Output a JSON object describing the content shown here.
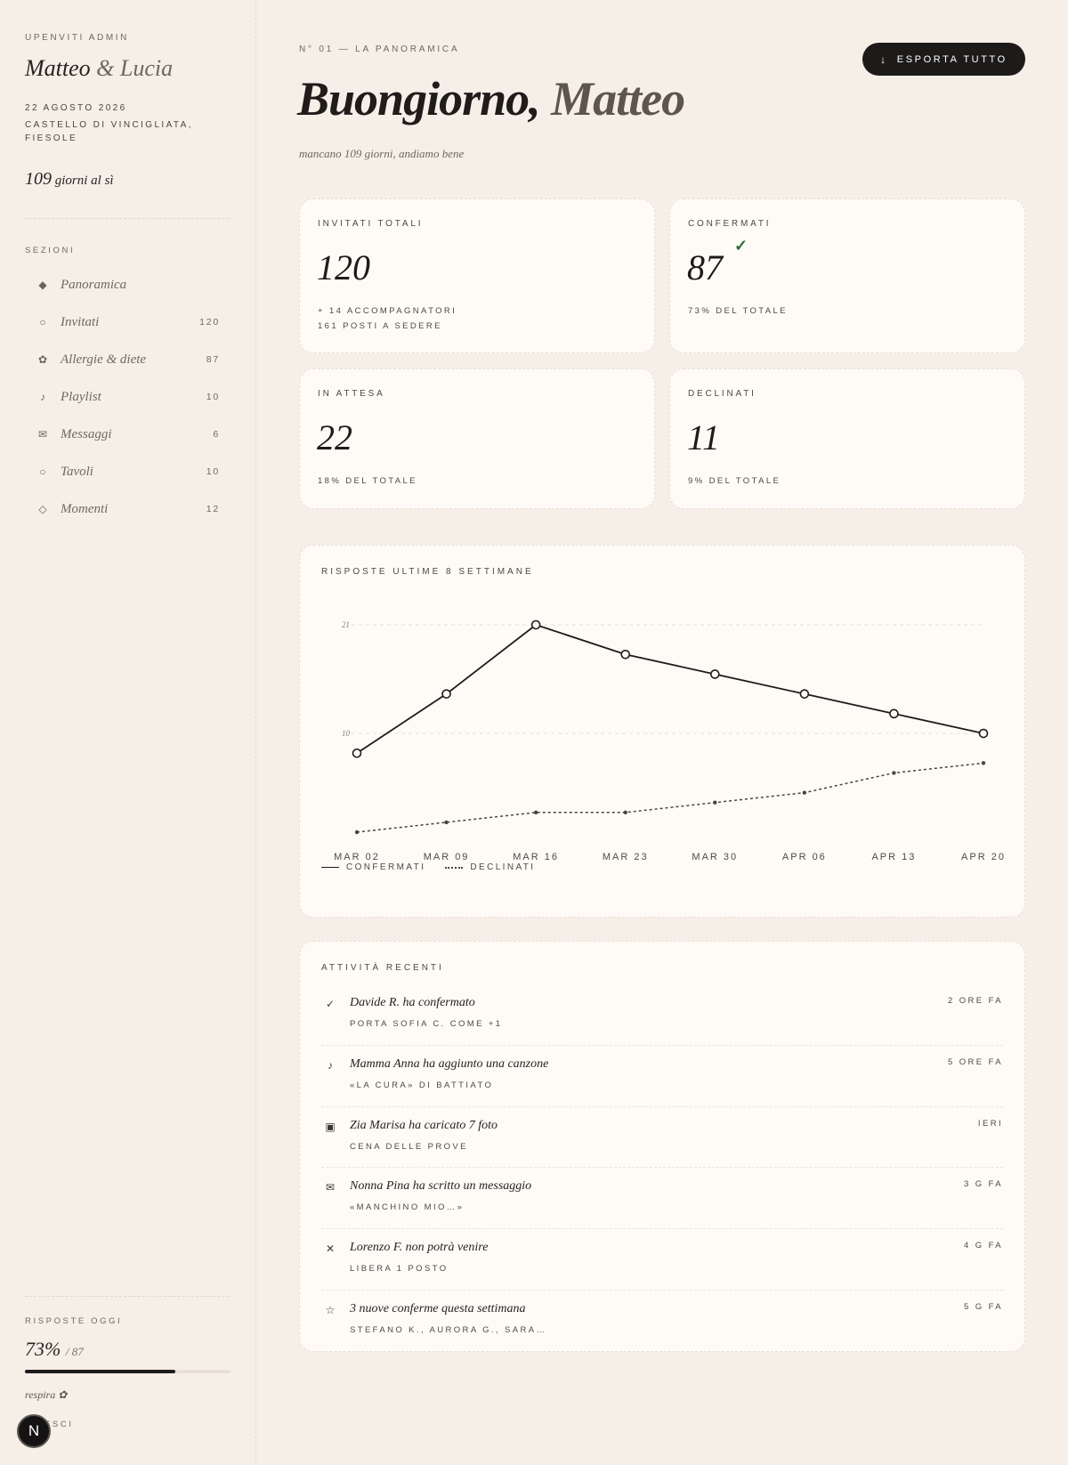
{
  "sidebar": {
    "brand": "UPENVITI ADMIN",
    "couple_first": "Matteo",
    "couple_amp": "&",
    "couple_second": "Lucia",
    "date": "22 AGOSTO 2026",
    "venue": "CASTELLO DI VINCIGLIATA, FIESOLE",
    "days_num": "109",
    "days_text": "giorni al sì",
    "sections_label": "SEZIONI",
    "items": [
      {
        "label": "Panoramica",
        "count": "",
        "icon": "diamond-filled-icon",
        "glyph": "◆",
        "active": true
      },
      {
        "label": "Invitati",
        "count": "120",
        "icon": "circle-outline-icon",
        "glyph": "○",
        "active": false
      },
      {
        "label": "Allergie & diete",
        "count": "87",
        "icon": "flower-icon",
        "glyph": "✿",
        "active": false
      },
      {
        "label": "Playlist",
        "count": "10",
        "icon": "music-note-icon",
        "glyph": "♪",
        "active": false
      },
      {
        "label": "Messaggi",
        "count": "6",
        "icon": "envelope-icon",
        "glyph": "✉",
        "active": false
      },
      {
        "label": "Tavoli",
        "count": "10",
        "icon": "ring-icon",
        "glyph": "○",
        "active": false
      },
      {
        "label": "Momenti",
        "count": "12",
        "icon": "diamond-outline-icon",
        "glyph": "◇",
        "active": false
      }
    ],
    "responses_label": "RISPOSTE OGGI",
    "responses_pct": "73%",
    "responses_of": "/ 87",
    "responses_fraction": 0.73,
    "breathe": "respira ✿",
    "exit_label": "ESCI",
    "avatar_letter": "N"
  },
  "header": {
    "eyebrow": "N° 01 — LA PANORAMICA",
    "greeting": "Buongiorno,",
    "name": "Matteo",
    "subtitle": "mancano 109 giorni, andiamo bene",
    "export_label": "ESPORTA TUTTO",
    "export_icon": "↓"
  },
  "stats": {
    "total": {
      "label": "INVITATI TOTALI",
      "value": "120",
      "note1": "+ 14 ACCOMPAGNATORI",
      "note2": "161 POSTI A SEDERE"
    },
    "confirmed": {
      "label": "CONFERMATI",
      "value": "87",
      "check": "✓",
      "note": "73% DEL TOTALE"
    },
    "pending": {
      "label": "IN ATTESA",
      "value": "22",
      "note": "18% DEL TOTALE"
    },
    "declined": {
      "label": "DECLINATI",
      "value": "11",
      "note": "9% DEL TOTALE"
    }
  },
  "chart_data": {
    "type": "line",
    "title": "RISPOSTE ULTIME 8 SETTIMANE",
    "categories": [
      "MAR 02",
      "MAR 09",
      "MAR 16",
      "MAR 23",
      "MAR 30",
      "APR 06",
      "APR 13",
      "APR 20"
    ],
    "y_ticks": [
      10,
      21
    ],
    "ylim": [
      0,
      21
    ],
    "grid": true,
    "legend_position": "bottom-left",
    "series": [
      {
        "name": "CONFERMATI",
        "style": "solid",
        "values": [
          8,
          14,
          21,
          18,
          16,
          14,
          12,
          10
        ]
      },
      {
        "name": "DECLINATI",
        "style": "dotted",
        "values": [
          0,
          1,
          2,
          2,
          3,
          4,
          6,
          7
        ]
      }
    ]
  },
  "activity": {
    "title": "ATTIVITÀ RECENTI",
    "items": [
      {
        "icon": "check-icon",
        "glyph": "✓",
        "main": "Davide R. ha confermato",
        "sub": "PORTA SOFIA C. COME +1",
        "time": "2 ORE FA"
      },
      {
        "icon": "music-note-icon",
        "glyph": "♪",
        "main": "Mamma Anna ha aggiunto una canzone",
        "sub": "«LA CURA» DI BATTIATO",
        "time": "5 ORE FA"
      },
      {
        "icon": "image-icon",
        "glyph": "▣",
        "main": "Zia Marisa ha caricato 7 foto",
        "sub": "CENA DELLE PROVE",
        "time": "IERI"
      },
      {
        "icon": "envelope-icon",
        "glyph": "✉",
        "main": "Nonna Pina ha scritto un messaggio",
        "sub": "«MANCHINO MIO…»",
        "time": "3 G FA"
      },
      {
        "icon": "close-icon",
        "glyph": "✕",
        "main": "Lorenzo F. non potrà venire",
        "sub": "LIBERA 1 POSTO",
        "time": "4 G FA"
      },
      {
        "icon": "star-icon",
        "glyph": "☆",
        "main": "3 nuove conferme questa settimana",
        "sub": "STEFANO K., AURORA G., SARA…",
        "time": "5 G FA"
      }
    ]
  }
}
